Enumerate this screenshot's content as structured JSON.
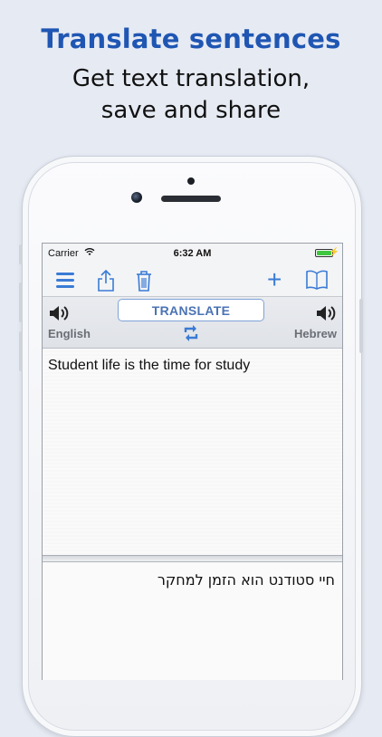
{
  "promo": {
    "headline": "Translate sentences",
    "subline_1": "Get text translation,",
    "subline_2": "save and share"
  },
  "statusbar": {
    "carrier": "Carrier",
    "time": "6:32 AM",
    "battery_color": "#3fc73f"
  },
  "toolbar": {
    "icons": [
      "menu-icon",
      "share-icon",
      "trash-icon",
      "plus-icon",
      "book-icon"
    ],
    "accent_color": "#3a7bd5"
  },
  "translator": {
    "translate_label": "TRANSLATE",
    "source_language": "English",
    "target_language": "Hebrew",
    "source_text": "Student life is the time for study",
    "target_text": "חיי סטודנט הוא הזמן למחקר"
  }
}
